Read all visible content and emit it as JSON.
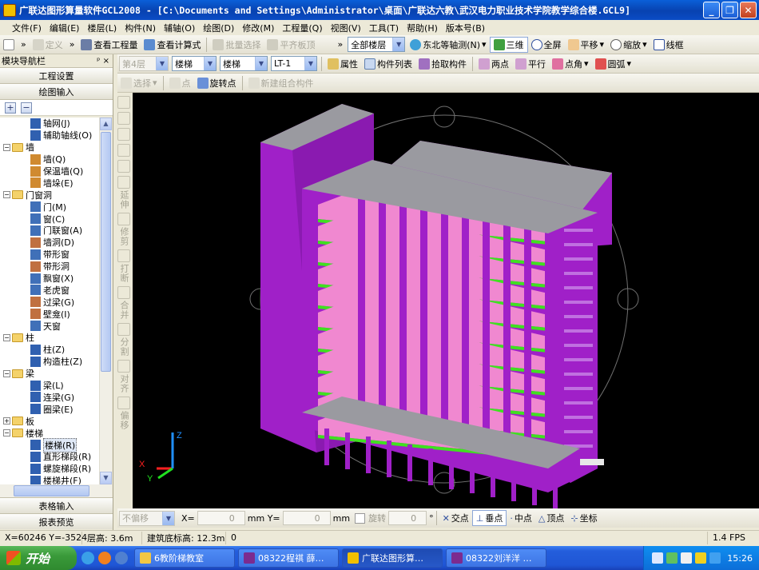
{
  "window": {
    "title": "广联达图形算量软件GCL2008 - [C:\\Documents and Settings\\Administrator\\桌面\\广联达六教\\武汉电力职业技术学院教学综合楼.GCL9]",
    "buttons": [
      "_",
      "❐",
      "✕"
    ]
  },
  "menu": [
    "文件(F)",
    "编辑(E)",
    "楼层(L)",
    "构件(N)",
    "辅轴(O)",
    "绘图(D)",
    "修改(M)",
    "工程量(Q)",
    "视图(V)",
    "工具(T)",
    "帮助(H)",
    "版本号(B)"
  ],
  "toolbar1": {
    "define": "定义",
    "view_quantity": "查看工程量",
    "view_formula": "查看计算式",
    "batch_select": "批量选择",
    "align_top": "平齐板顶",
    "all_floors": "全部楼层",
    "view_angle": "东北等轴测(N)",
    "view_3d": "三维",
    "fullscreen": "全屏",
    "pan": "平移",
    "zoom": "缩放",
    "wireframe": "线框"
  },
  "toolbar2": {
    "floor": "第4层",
    "category": "楼梯",
    "type": "楼梯",
    "component": "LT-1",
    "properties": "属性",
    "component_list": "构件列表",
    "pick_component": "拾取构件",
    "two_points": "两点",
    "parallel": "平行",
    "point_angle": "点角",
    "arc": "圆弧"
  },
  "toolbar3": {
    "select": "选择",
    "point": "点",
    "rotate_point": "旋转点",
    "new_combo": "新建组合构件"
  },
  "nav": {
    "title": "模块导航栏",
    "pin": "ᵖ ×",
    "tab_settings": "工程设置",
    "tab_drawing": "绘图输入",
    "tab_table": "表格输入",
    "tab_report": "报表预览",
    "tree": [
      {
        "type": "leaf",
        "label": "轴网(J)",
        "color": "#3060b0"
      },
      {
        "type": "leaf",
        "label": "辅助轴线(O)",
        "color": "#3060b0"
      },
      {
        "type": "folder",
        "label": "墙",
        "state": "−"
      },
      {
        "type": "leaf",
        "label": "墙(Q)",
        "color": "#d08a30"
      },
      {
        "type": "leaf",
        "label": "保温墙(Q)",
        "color": "#d08a30"
      },
      {
        "type": "leaf",
        "label": "墙垛(E)",
        "color": "#d08a30"
      },
      {
        "type": "folder",
        "label": "门窗洞",
        "state": "−"
      },
      {
        "type": "leaf",
        "label": "门(M)",
        "color": "#4070b8"
      },
      {
        "type": "leaf",
        "label": "窗(C)",
        "color": "#4070b8"
      },
      {
        "type": "leaf",
        "label": "门联窗(A)",
        "color": "#4070b8"
      },
      {
        "type": "leaf",
        "label": "墙洞(D)",
        "color": "#c07040"
      },
      {
        "type": "leaf",
        "label": "带形窗",
        "color": "#4070b8"
      },
      {
        "type": "leaf",
        "label": "带形洞",
        "color": "#c07040"
      },
      {
        "type": "leaf",
        "label": "飘窗(X)",
        "color": "#4070b8"
      },
      {
        "type": "leaf",
        "label": "老虎窗",
        "color": "#4070b8"
      },
      {
        "type": "leaf",
        "label": "过梁(G)",
        "color": "#c07040"
      },
      {
        "type": "leaf",
        "label": "壁龛(I)",
        "color": "#c07040"
      },
      {
        "type": "leaf",
        "label": "天窗",
        "color": "#4070b8"
      },
      {
        "type": "folder",
        "label": "柱",
        "state": "−"
      },
      {
        "type": "leaf",
        "label": "柱(Z)",
        "color": "#3060b0"
      },
      {
        "type": "leaf",
        "label": "构造柱(Z)",
        "color": "#3060b0"
      },
      {
        "type": "folder",
        "label": "梁",
        "state": "−"
      },
      {
        "type": "leaf",
        "label": "梁(L)",
        "color": "#3060b0"
      },
      {
        "type": "leaf",
        "label": "连梁(G)",
        "color": "#3060b0"
      },
      {
        "type": "leaf",
        "label": "圈梁(E)",
        "color": "#3060b0"
      },
      {
        "type": "folder",
        "label": "板",
        "state": "+"
      },
      {
        "type": "folder",
        "label": "楼梯",
        "state": "−"
      },
      {
        "type": "leaf",
        "label": "楼梯(R)",
        "color": "#3060b0",
        "selected": true
      },
      {
        "type": "leaf",
        "label": "直形梯段(R)",
        "color": "#3060b0"
      },
      {
        "type": "leaf",
        "label": "螺旋梯段(R)",
        "color": "#3060b0"
      },
      {
        "type": "leaf",
        "label": "楼梯井(F)",
        "color": "#3060b0"
      }
    ]
  },
  "vtool": {
    "extend": "延伸",
    "trim": "修剪",
    "break": "打断",
    "merge": "合并",
    "split": "分割",
    "align": "对齐",
    "offset": "偏移"
  },
  "snapbar": {
    "mode": "不偏移",
    "x_label": "X=",
    "x_value": "0",
    "y_label": "mm Y=",
    "y_value": "0",
    "unit": "mm",
    "rotate_label": "旋转",
    "rotate_value": "0",
    "degree": "°",
    "intersection": "交点",
    "perpendicular": "垂点",
    "midpoint": "中点",
    "vertex": "顶点",
    "coordinate": "坐标"
  },
  "status": {
    "coords": "X=60246 Y=-3524",
    "floor_height": "层高: 3.6m",
    "bottom_elev": "建筑底标高: 12.3m",
    "count": "0",
    "fps": "1.4 FPS"
  },
  "taskbar": {
    "start": "开始",
    "tasks": [
      {
        "label": "6教阶梯教室",
        "color": "#f2c744"
      },
      {
        "label": "08322程祺 薛…",
        "color": "#7c2b8f"
      },
      {
        "label": "广联达图形算…",
        "color": "#f0c000"
      },
      {
        "label": "08322刘洋洋 …",
        "color": "#7c2b8f"
      }
    ],
    "clock": "15:26"
  },
  "colors": {
    "wall": "#a020c8",
    "slab": "#f088d0",
    "beam_green": "#40e020",
    "roof": "#9a9aa0",
    "axis_z": "#2090ff",
    "axis_x": "#ff2020",
    "axis_y": "#20e020"
  }
}
